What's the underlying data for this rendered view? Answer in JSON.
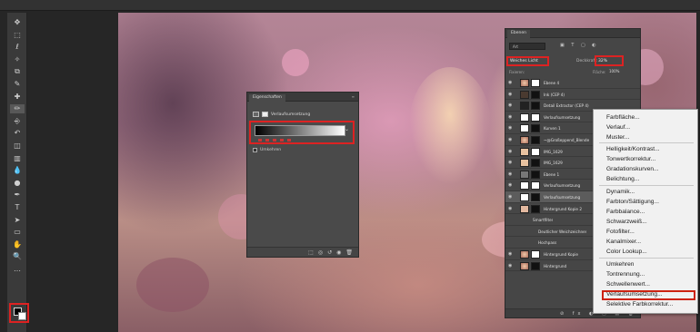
{
  "tools": [
    "move",
    "marquee",
    "lasso",
    "magic-wand",
    "crop",
    "eyedropper",
    "healing-brush",
    "brush",
    "stamp",
    "history-brush",
    "eraser",
    "gradient",
    "blur",
    "dodge",
    "pen",
    "type",
    "path-select",
    "shape",
    "hand",
    "zoom",
    "more"
  ],
  "properties": {
    "tab": "Eigenschaften",
    "title": "Verlaufsumsetzung",
    "checkbox": "Umkehren"
  },
  "layers": {
    "tab": "Ebenen",
    "filter": "Art",
    "blend_mode": "Weiches Licht",
    "opacity_label": "Deckkraft:",
    "opacity": "32%",
    "fix_label": "Fixieren:",
    "fill_label": "Fläche:",
    "fill": "100%",
    "rows": [
      {
        "name": "Ebene 4",
        "sub": 0,
        "sel": false
      },
      {
        "name": "Ink (CEP 4)",
        "sub": 0,
        "sel": false
      },
      {
        "name": "Detail Extractor (CEP 4)",
        "sub": 0,
        "sel": false
      },
      {
        "name": "Verlaufsumsetzung",
        "sub": 0,
        "sel": false
      },
      {
        "name": "Kurven 1",
        "sub": 0,
        "sel": false
      },
      {
        "name": "~@Großeppend_Blende",
        "sub": 0,
        "sel": false
      },
      {
        "name": "IMG_1629",
        "sub": 0,
        "sel": false
      },
      {
        "name": "IMG_1629",
        "sub": 0,
        "sel": false
      },
      {
        "name": "Ebene 1",
        "sub": 0,
        "sel": false
      },
      {
        "name": "Verlaufsumsetzung",
        "sub": 0,
        "sel": false
      },
      {
        "name": "Verlaufsumsetzung",
        "sub": 0,
        "sel": true
      },
      {
        "name": "Hintergrund Kopie 2",
        "sub": 0,
        "sel": false
      },
      {
        "name": "Smartfilter",
        "sub": 1,
        "sel": false
      },
      {
        "name": "Deutlicher Weichzeichner",
        "sub": 2,
        "sel": false
      },
      {
        "name": "Hochpass",
        "sub": 2,
        "sel": false
      },
      {
        "name": "Hintergrund Kopie",
        "sub": 0,
        "sel": false
      },
      {
        "name": "Hintergrund",
        "sub": 0,
        "sel": false
      }
    ]
  },
  "menu": {
    "items": [
      "Farbfläche...",
      "Verlauf...",
      "Muster...",
      "Helligkeit/Kontrast...",
      "Tonwertkorrektur...",
      "Gradationskurven...",
      "Belichtung...",
      "Dynamik...",
      "Farbton/Sättigung...",
      "Farbbalance...",
      "Schwarzweiß...",
      "Fotofilter...",
      "Kanalmixer...",
      "Color Lookup...",
      "Umkehren",
      "Tontrennung...",
      "Schwellenwert...",
      "Verlaufsumsetzung...",
      "Selektive Farbkorrektur..."
    ],
    "highlighted": "Verlaufsumsetzung..."
  },
  "colors": {
    "highlight_border": "#d22222",
    "panel_bg": "#464646"
  }
}
